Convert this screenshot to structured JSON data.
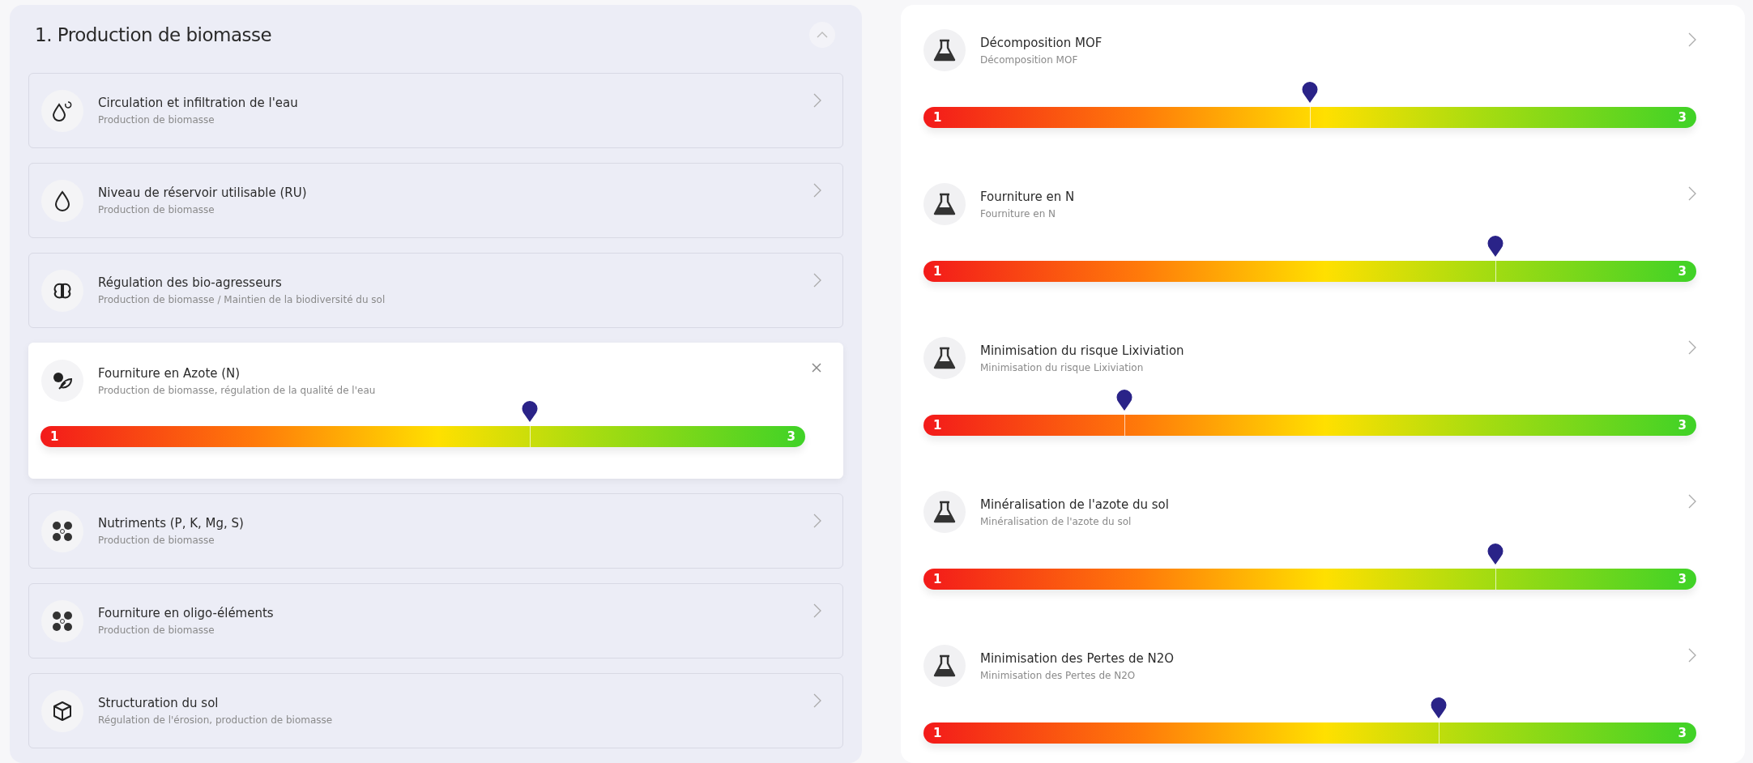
{
  "section": {
    "title": "1. Production de biomasse",
    "expanded": true,
    "items": [
      {
        "title": "Circulation et infiltration de l'eau",
        "subtitle": "Production de biomasse",
        "expanded": false
      },
      {
        "title": "Niveau de réservoir utilisable (RU)",
        "subtitle": "Production de biomasse",
        "expanded": false
      },
      {
        "title": "Régulation des bio-agresseurs",
        "subtitle": "Production de biomasse / Maintien de la biodiversité du sol",
        "expanded": false
      },
      {
        "title": "Fourniture en Azote (N)",
        "subtitle": "Production de biomasse, régulation de la qualité de l'eau",
        "expanded": true,
        "gauge": {
          "min": "1",
          "max": "3",
          "level": 0.64
        }
      },
      {
        "title": "Nutriments (P, K, Mg, S)",
        "subtitle": "Production de biomasse",
        "expanded": false
      },
      {
        "title": "Fourniture en oligo-éléments",
        "subtitle": "Production de biomasse",
        "expanded": false
      },
      {
        "title": "Structuration du sol",
        "subtitle": "Régulation de l'érosion, production de biomasse",
        "expanded": false
      }
    ]
  },
  "indicators": [
    {
      "title": "Décomposition MOF",
      "subtitle": "Décomposition MOF",
      "gauge": {
        "min": "1",
        "max": "3",
        "level": 0.5
      }
    },
    {
      "title": "Fourniture en N",
      "subtitle": "Fourniture en N",
      "gauge": {
        "min": "1",
        "max": "3",
        "level": 0.74
      }
    },
    {
      "title": "Minimisation du risque Lixiviation",
      "subtitle": "Minimisation du risque Lixiviation",
      "gauge": {
        "min": "1",
        "max": "3",
        "level": 0.26
      }
    },
    {
      "title": "Minéralisation de l'azote du sol",
      "subtitle": "Minéralisation de l'azote du sol",
      "gauge": {
        "min": "1",
        "max": "3",
        "level": 0.74
      }
    },
    {
      "title": "Minimisation des Pertes de N2O",
      "subtitle": "Minimisation des Pertes de N2O",
      "gauge": {
        "min": "1",
        "max": "3",
        "level": 0.667
      }
    }
  ]
}
